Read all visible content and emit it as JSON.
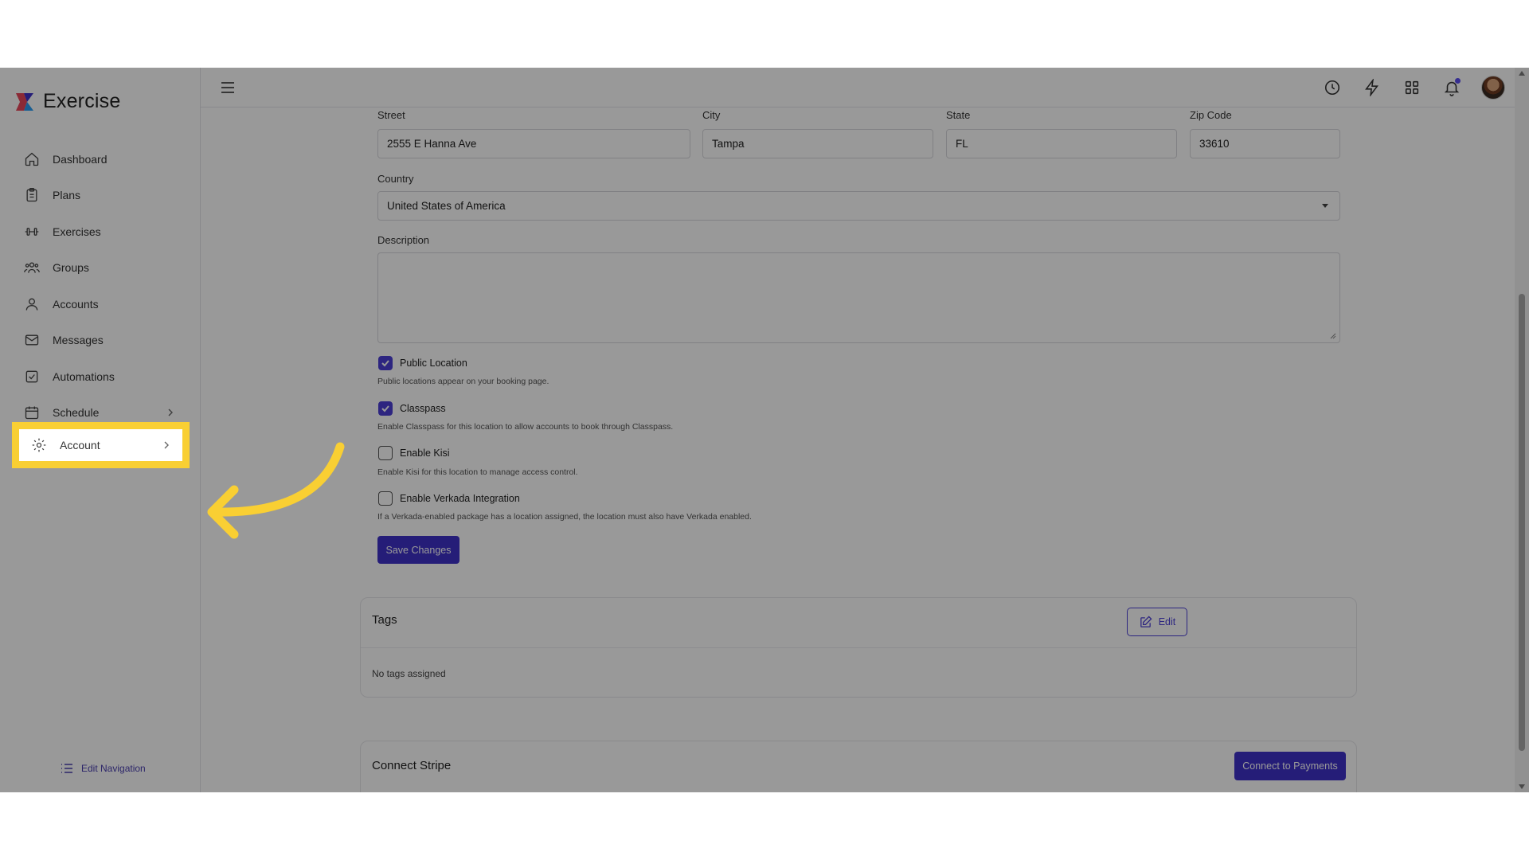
{
  "brand": {
    "name": "Exercise",
    "accent": "#4b3fd6"
  },
  "sidebar": {
    "items": [
      {
        "label": "Dashboard",
        "icon": "home-icon"
      },
      {
        "label": "Plans",
        "icon": "clipboard-icon"
      },
      {
        "label": "Exercises",
        "icon": "dumbbell-icon"
      },
      {
        "label": "Groups",
        "icon": "users-icon"
      },
      {
        "label": "Accounts",
        "icon": "user-icon"
      },
      {
        "label": "Messages",
        "icon": "mail-icon"
      },
      {
        "label": "Automations",
        "icon": "checkbox-icon"
      },
      {
        "label": "Schedule",
        "icon": "calendar-icon"
      },
      {
        "label": "Account",
        "icon": "gear-icon"
      }
    ],
    "edit_navigation": "Edit Navigation"
  },
  "form": {
    "street": {
      "label": "Street",
      "value": "2555 E Hanna Ave"
    },
    "city": {
      "label": "City",
      "value": "Tampa"
    },
    "state": {
      "label": "State",
      "value": "FL"
    },
    "zip": {
      "label": "Zip Code",
      "value": "33610"
    },
    "country": {
      "label": "Country",
      "value": "United States of America"
    },
    "description": {
      "label": "Description",
      "value": ""
    },
    "public_location": {
      "label": "Public Location",
      "help": "Public locations appear on your booking page.",
      "checked": true
    },
    "classpass": {
      "label": "Classpass",
      "help": "Enable Classpass for this location to allow accounts to book through Classpass.",
      "checked": true
    },
    "kisi": {
      "label": "Enable Kisi",
      "help": "Enable Kisi for this location to manage access control.",
      "checked": false
    },
    "verkada": {
      "label": "Enable Verkada Integration",
      "help": "If a Verkada-enabled package has a location assigned, the location must also have Verkada enabled.",
      "checked": false
    },
    "save_label": "Save Changes"
  },
  "tags": {
    "title": "Tags",
    "edit_label": "Edit",
    "empty_text": "No tags assigned"
  },
  "stripe": {
    "title": "Connect Stripe",
    "button_label": "Connect to Payments"
  }
}
